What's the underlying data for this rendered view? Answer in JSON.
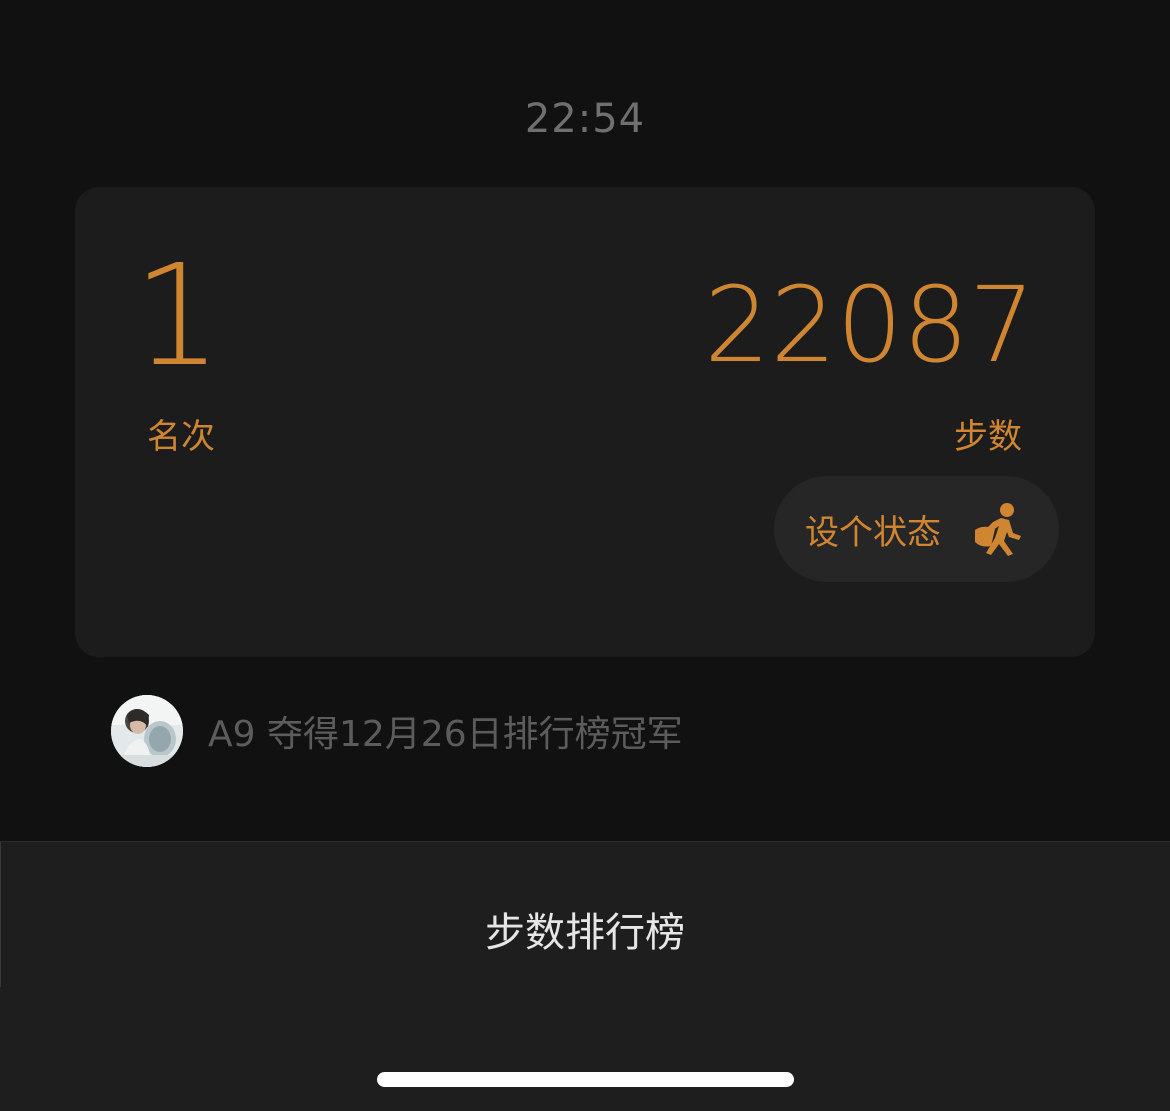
{
  "status_bar": {
    "time": "22:54"
  },
  "card": {
    "rank_value": "1",
    "rank_label": "名次",
    "steps_value": "22087",
    "steps_label": "步数",
    "status_button_label": "设个状态",
    "status_icon": "walking-person-icon"
  },
  "champion": {
    "avatar": "user-avatar-photo",
    "text": "A9 夺得12月26日排行榜冠军"
  },
  "bottom_panel": {
    "title": "步数排行榜"
  },
  "colors": {
    "accent": "#d08531",
    "background": "#111111",
    "card": "#1c1c1c",
    "panel": "#1e1e1e",
    "muted_text": "#5c5c5c"
  }
}
